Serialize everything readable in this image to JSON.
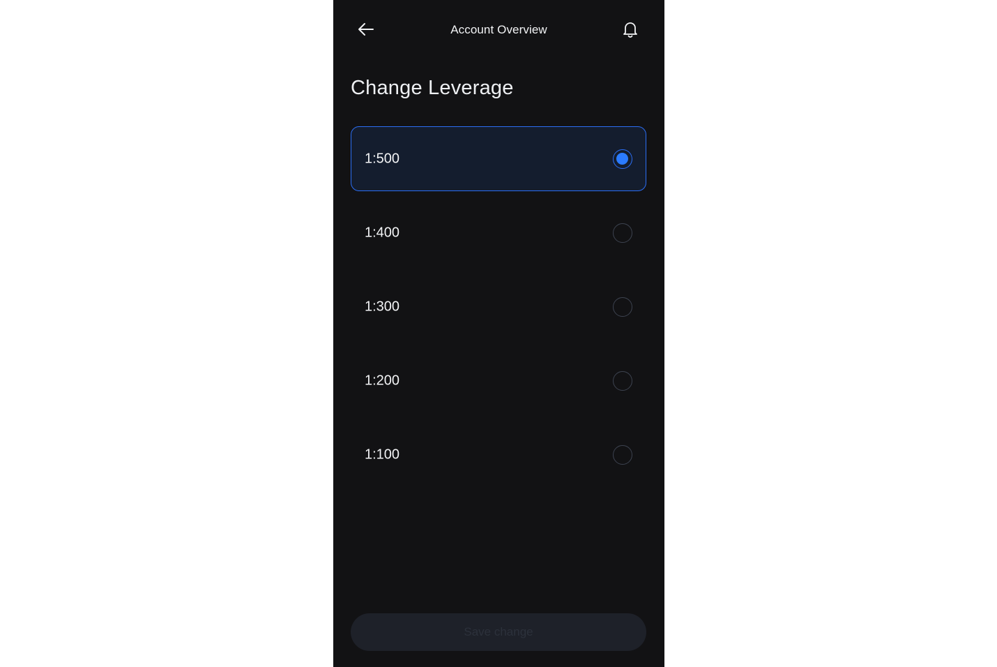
{
  "header": {
    "title": "Account Overview",
    "back_icon": "arrow-left-icon",
    "notification_icon": "bell-icon"
  },
  "page": {
    "title": "Change Leverage"
  },
  "leverage_options": [
    {
      "label": "1:500",
      "selected": true
    },
    {
      "label": "1:400",
      "selected": false
    },
    {
      "label": "1:300",
      "selected": false
    },
    {
      "label": "1:200",
      "selected": false
    },
    {
      "label": "1:100",
      "selected": false
    }
  ],
  "footer": {
    "save_label": "Save change",
    "save_disabled": true
  },
  "colors": {
    "background": "#121214",
    "accent": "#2b7bff",
    "selected_bg": "#141d2e"
  }
}
